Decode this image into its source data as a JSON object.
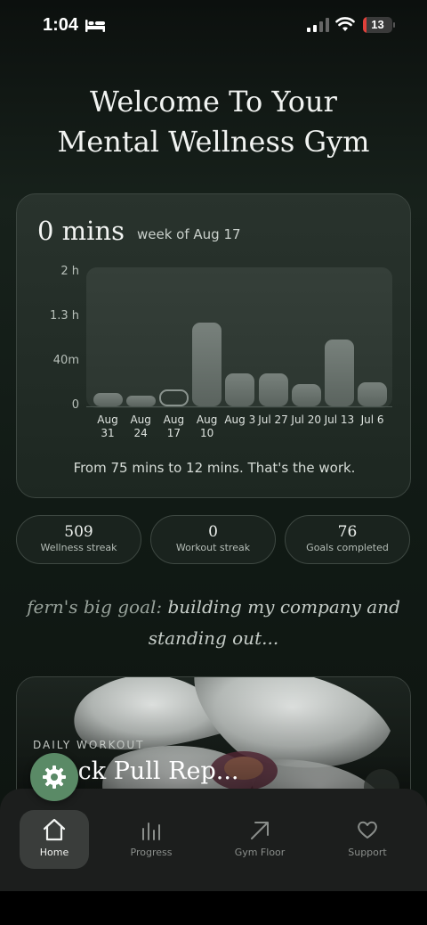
{
  "status_bar": {
    "time": "1:04",
    "battery": 13,
    "icons": [
      "bed-icon",
      "cellular-signal-icon",
      "wifi-icon",
      "battery-icon"
    ]
  },
  "welcome": {
    "line1": "Welcome To Your",
    "line2": "Mental Wellness Gym"
  },
  "stats": {
    "minutes": "0 mins",
    "week_label": "week of Aug 17",
    "summary": "From 75 mins to 12 mins. That's the work."
  },
  "chart_data": {
    "type": "bar",
    "categories": [
      "Aug 31",
      "Aug 24",
      "Aug 17",
      "Aug 10",
      "Aug 3",
      "Jul 27",
      "Jul 20",
      "Jul 13",
      "Jul 6"
    ],
    "x_tick_lines": [
      [
        "Aug",
        "31"
      ],
      [
        "Aug",
        "24"
      ],
      [
        "Aug",
        "17"
      ],
      [
        "Aug",
        "10"
      ],
      [
        "Aug 3"
      ],
      [
        "Jul 27"
      ],
      [
        "Jul 20"
      ],
      [
        "Jul 13"
      ],
      [
        "Jul 6"
      ]
    ],
    "values": [
      12,
      10,
      15,
      75,
      30,
      30,
      20,
      60,
      22
    ],
    "unit": "minutes",
    "ylim": [
      0,
      120
    ],
    "yticks": [
      {
        "value": 0,
        "label": "0"
      },
      {
        "value": 40,
        "label": "40m"
      },
      {
        "value": 80,
        "label": "1.3 h"
      },
      {
        "value": 120,
        "label": "2 h"
      }
    ],
    "current_category": "Aug 17",
    "grid": false
  },
  "streaks": [
    {
      "value": "509",
      "label": "Wellness streak"
    },
    {
      "value": "0",
      "label": "Workout streak"
    },
    {
      "value": "76",
      "label": "Goals completed"
    }
  ],
  "goal": {
    "prefix": "fern's big goal:",
    "text": "building my company and standing out..."
  },
  "workout": {
    "kicker": "DAILY WORKOUT",
    "title": "dback Pull Rep..."
  },
  "tabs": [
    {
      "label": "Home",
      "icon": "home-icon",
      "active": true
    },
    {
      "label": "Progress",
      "icon": "progress-bars-icon",
      "active": false
    },
    {
      "label": "Gym Floor",
      "icon": "arrow-up-right-icon",
      "active": false
    },
    {
      "label": "Support",
      "icon": "heart-icon",
      "active": false
    }
  ],
  "colors": {
    "accent_green": "#5a8a66",
    "background": "#111a15",
    "bar": "#6a736e"
  }
}
